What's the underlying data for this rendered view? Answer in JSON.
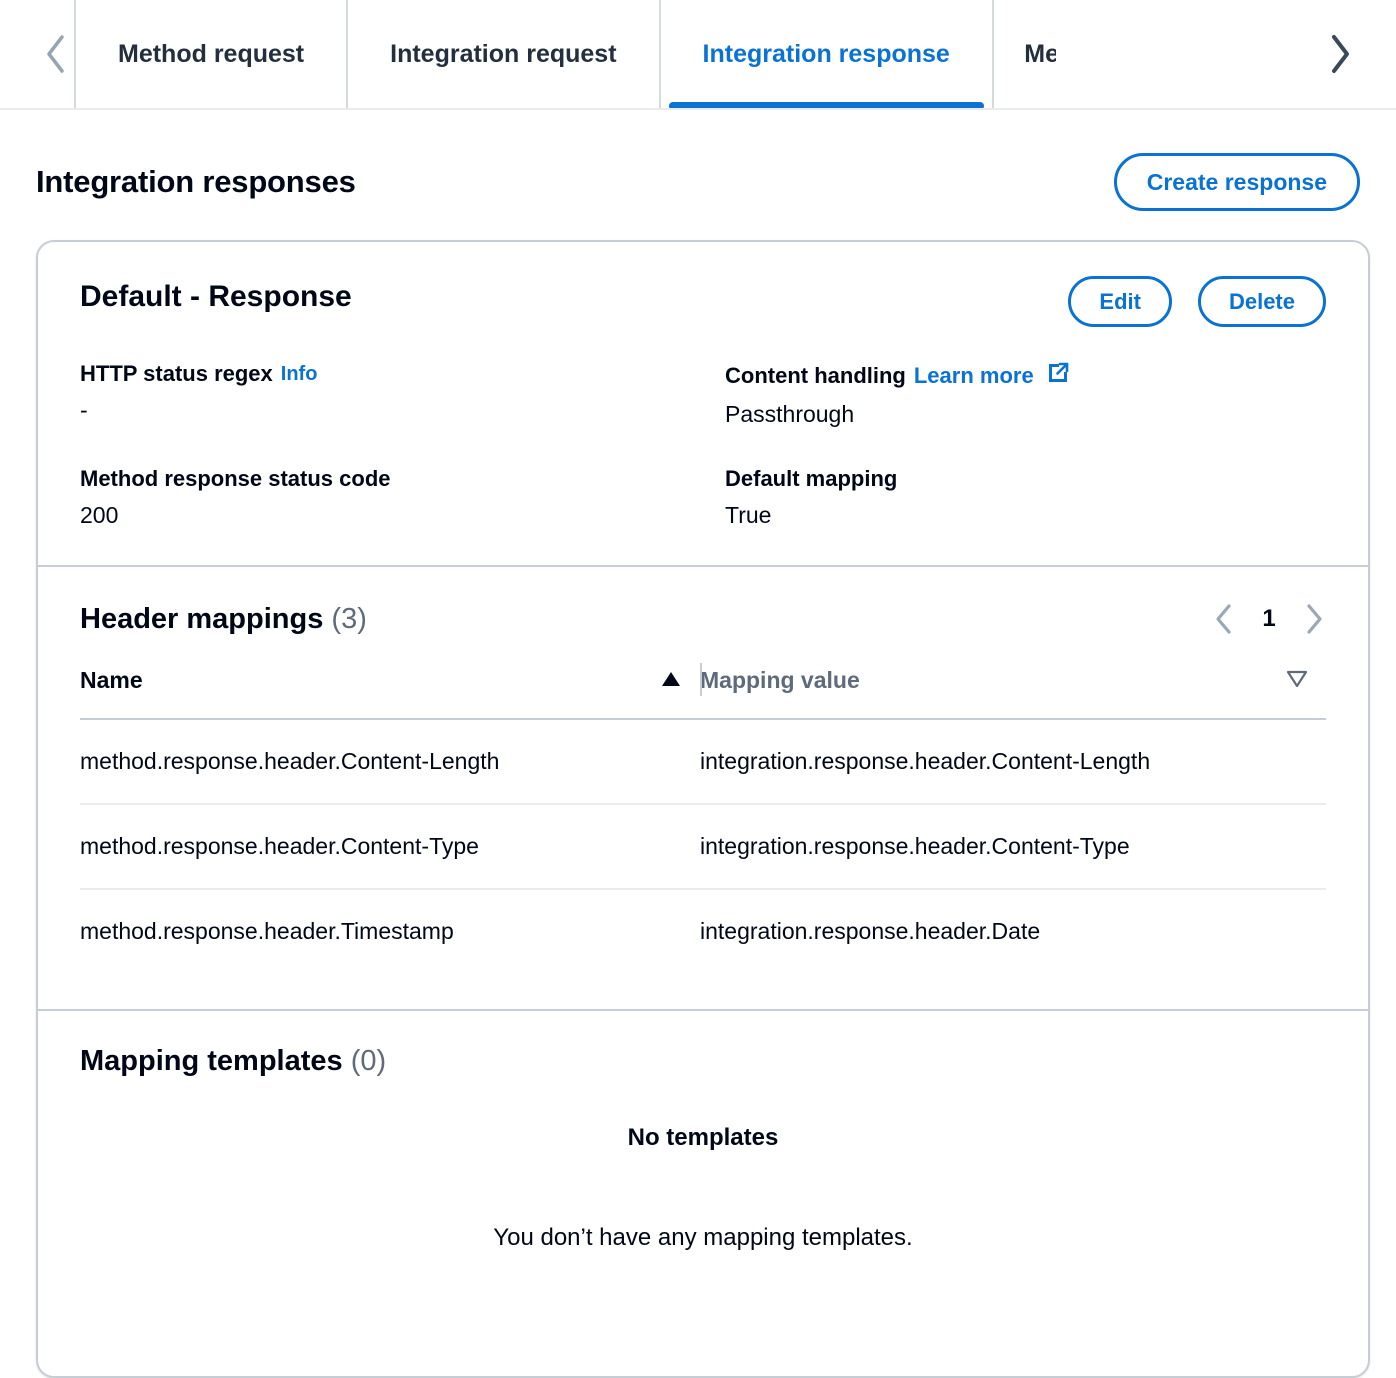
{
  "tabs": {
    "scroll_left_icon": "chevron-left-icon",
    "scroll_right_icon": "chevron-right-icon",
    "items": [
      {
        "label": "Method request",
        "selected": false
      },
      {
        "label": "Integration request",
        "selected": false
      },
      {
        "label": "Integration response",
        "selected": true
      },
      {
        "label": "Met",
        "selected": false,
        "truncated": true
      }
    ]
  },
  "header": {
    "title": "Integration responses",
    "create_button": "Create response"
  },
  "response_card": {
    "title": "Default - Response",
    "edit_button": "Edit",
    "delete_button": "Delete",
    "details": [
      {
        "label": "HTTP status regex",
        "info_link": "Info",
        "value": "-"
      },
      {
        "label": "Content handling",
        "learn_more_link": "Learn more",
        "external_icon": "external-link-icon",
        "value": "Passthrough"
      },
      {
        "label": "Method response status code",
        "value": "200"
      },
      {
        "label": "Default mapping",
        "value": "True"
      }
    ]
  },
  "header_mappings": {
    "title": "Header mappings",
    "count": "(3)",
    "pagination": {
      "prev_icon": "chevron-left-icon",
      "next_icon": "chevron-right-icon",
      "current_page": "1"
    },
    "columns": [
      {
        "label": "Name",
        "sort_icon": "sort-ascending-triangle-icon",
        "active": true
      },
      {
        "label": "Mapping value",
        "sort_icon": "sort-descending-triangle-icon",
        "active": false
      }
    ],
    "rows": [
      {
        "name": "method.response.header.Content-Length",
        "value": "integration.response.header.Content-Length"
      },
      {
        "name": "method.response.header.Content-Type",
        "value": "integration.response.header.Content-Type"
      },
      {
        "name": "method.response.header.Timestamp",
        "value": "integration.response.header.Date"
      }
    ]
  },
  "mapping_templates": {
    "title": "Mapping templates",
    "count": "(0)",
    "empty_title": "No templates",
    "empty_body": "You don’t have any mapping templates."
  },
  "colors": {
    "accent": "#0972d3",
    "text": "#000716",
    "muted": "#5f6b7a",
    "border": "#c6cdd5",
    "row_border": "#e9ebed"
  }
}
